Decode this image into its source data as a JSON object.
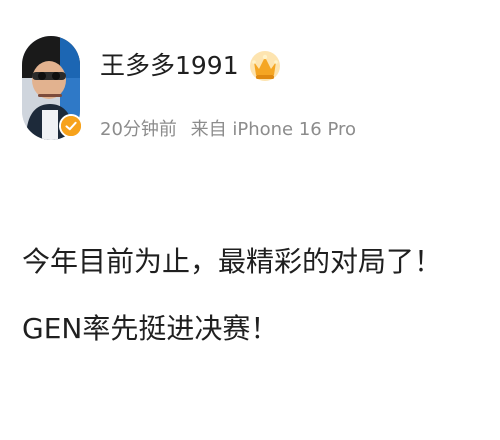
{
  "post": {
    "author": {
      "username": "王多多1991",
      "verified": true
    },
    "meta": {
      "time_ago": "20分钟前",
      "source": "来自 iPhone 16 Pro"
    },
    "content": {
      "line_1": "今年目前为止，最精彩的对局了！",
      "line_2": "GEN率先挺进决赛！"
    }
  },
  "colors": {
    "text_primary": "#1f1f1f",
    "text_meta": "#8c8c8c",
    "badge_orange": "#f7a21b",
    "background": "#ffffff"
  },
  "icons": {
    "avatar": "user-avatar",
    "verified": "verified-badge-icon",
    "crown": "crown-badge-icon"
  }
}
